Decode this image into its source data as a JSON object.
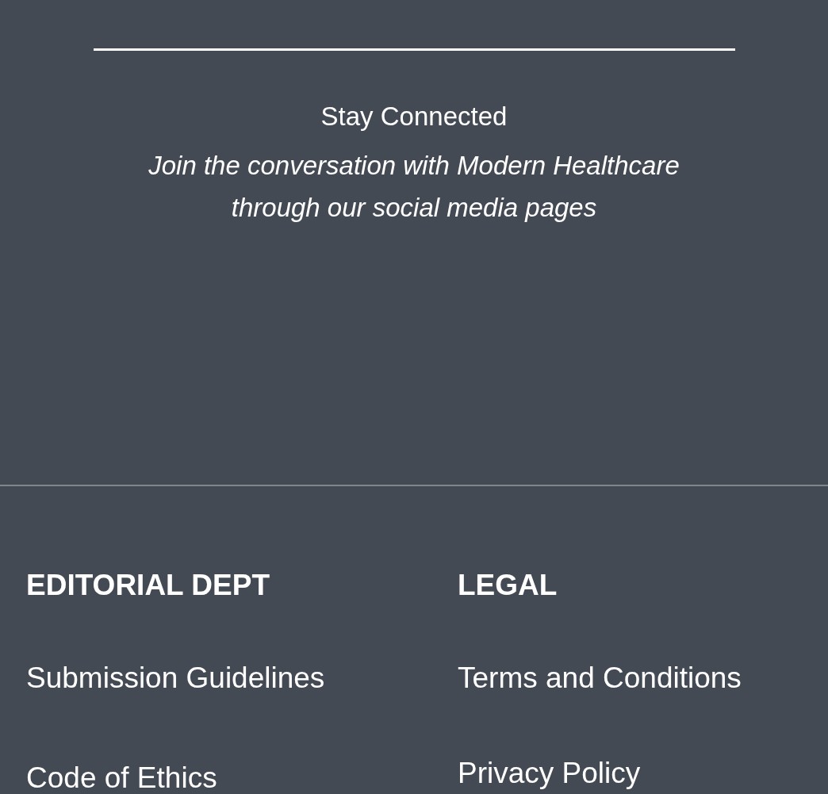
{
  "social": {
    "title": "Stay Connected",
    "subtitle": "Join the conversation with Modern Healthcare through our social media pages"
  },
  "columns": [
    {
      "heading": "EDITORIAL DEPT",
      "links": [
        "Submission Guidelines",
        "Code of Ethics"
      ]
    },
    {
      "heading": "LEGAL",
      "links": [
        "Terms and Conditions",
        "Privacy Policy"
      ]
    }
  ]
}
